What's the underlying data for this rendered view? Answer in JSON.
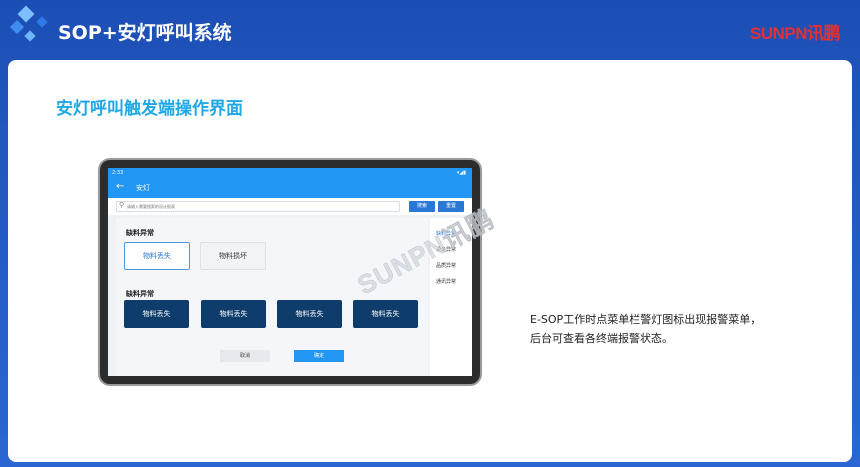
{
  "header": {
    "title": "SOP+安灯呼叫系统",
    "brand": "SUNPN讯鹏"
  },
  "card": {
    "title": "安灯呼叫触发端操作界面",
    "description_line1": "E-SOP工作时点菜单栏警灯图标出现报警菜单，",
    "description_line2": "后台可查看各终端报警状态。"
  },
  "tablet": {
    "status_time": "2:33",
    "status_icons": "▾◢▮",
    "appbar_title": "安灯",
    "search_placeholder": "请输入需要搜索的设计报表",
    "search_button": "搜索",
    "reset_button": "重置",
    "section1_label": "缺料异常",
    "section1_options": [
      "物料丢失",
      "物料损坏"
    ],
    "section2_label": "缺料异常",
    "section2_options": [
      "物料丢失",
      "物料丢失",
      "物料丢失",
      "物料丢失"
    ],
    "cancel_button": "取消",
    "confirm_button": "确定",
    "side_menu": [
      "缺料异常",
      "设备异常",
      "品质异常",
      "通讯异常"
    ]
  },
  "watermark": "SUNPN讯鹏",
  "colors": {
    "header_bg": "#1c4fb5",
    "title_accent": "#1fa8e8",
    "brand_red": "#e53030",
    "app_blue": "#2196f3",
    "dark_button": "#0e3d6b"
  }
}
